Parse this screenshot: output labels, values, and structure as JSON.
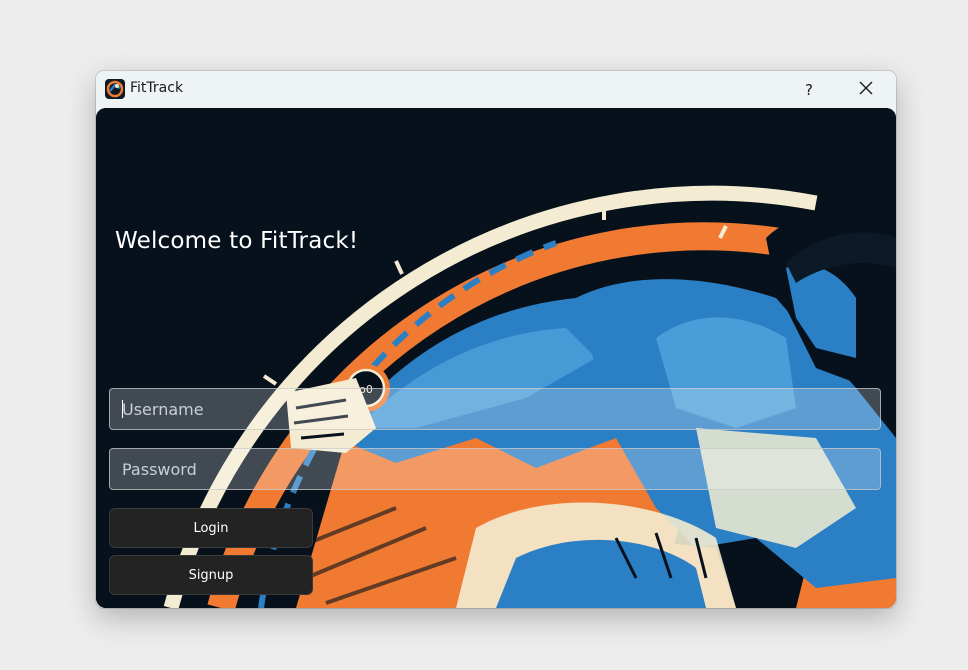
{
  "window": {
    "title": "FitTrack",
    "help_label": "?",
    "app_icon": "fittrack-logo-icon",
    "close_icon": "close-icon"
  },
  "main": {
    "welcome": "Welcome to FitTrack!",
    "username": {
      "value": "",
      "placeholder": "Username"
    },
    "password": {
      "value": "",
      "placeholder": "Password"
    },
    "login_label": "Login",
    "signup_label": "Signup"
  },
  "colors": {
    "background_dark": "#06111c",
    "accent_orange": "#f07a32",
    "accent_blue": "#2b7fc4",
    "cream": "#f3ecd2",
    "button": "#232323"
  }
}
